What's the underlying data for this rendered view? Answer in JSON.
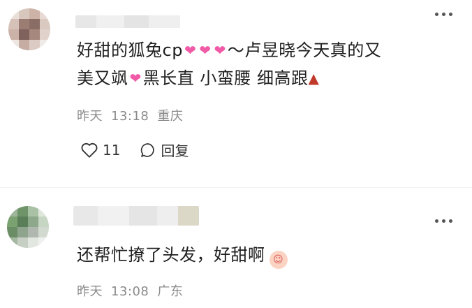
{
  "comments": [
    {
      "text_parts": [
        "好甜的狐兔cp",
        "～卢昱晓今天真的又",
        "美又飒",
        "黑长直 小蛮腰 细高跟"
      ],
      "date": "昨天",
      "time": "13:18",
      "location": "重庆",
      "likes": "11",
      "reply_label": "回复",
      "heart_glyph": "💕",
      "heel_glyph": "👠"
    },
    {
      "text_parts": [
        "还帮忙撩了头发，好甜啊"
      ],
      "date": "昨天",
      "time": "13:08",
      "location": "广东"
    }
  ],
  "icons": {
    "more": "more-dots-icon",
    "like": "heart-outline-icon",
    "reply": "comment-bubble-icon",
    "heart": "double-heart-emoji-icon",
    "heel": "high-heel-emoji-icon",
    "face": "smiling-face-emoji-icon"
  },
  "colors": {
    "text": "#1f1f1f",
    "meta": "#8a8a8a",
    "heart": "#f05aa6"
  }
}
